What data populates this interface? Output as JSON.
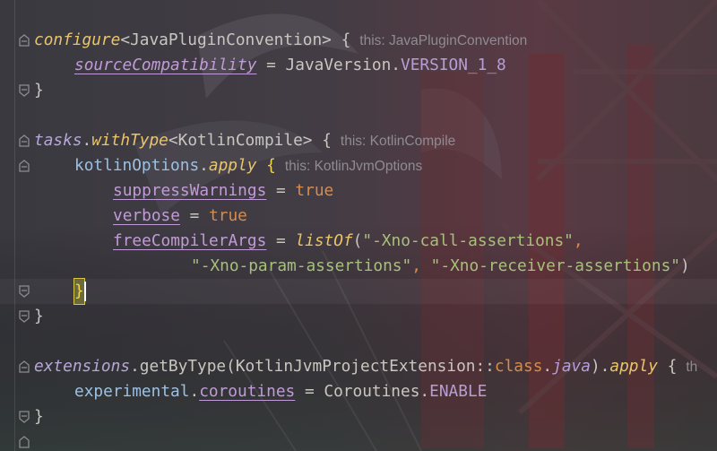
{
  "colors": {
    "background": "#3b3a40",
    "function_italic": "#e8c46a",
    "property": "#c19bd8",
    "keyword": "#d98b4a",
    "string": "#a7c07a",
    "hint": "#8e8c92",
    "brace_highlight": "#f0d34a"
  },
  "editor": {
    "lines": [
      {
        "kind": "l1",
        "fn": "configure",
        "type_arg": "<JavaPluginConvention>",
        "brace": " {",
        "hint": "this: JavaPluginConvention"
      },
      {
        "kind": "l2",
        "prop": "sourceCompatibility",
        "eq": " = ",
        "cls": "JavaVersion.",
        "const": "VERSION_1_8"
      },
      {
        "kind": "close",
        "text": "}"
      },
      {
        "kind": "l4",
        "recv": "tasks",
        "dot": ".",
        "fn": "withType",
        "type_arg": "<KotlinCompile>",
        "brace": " {",
        "hint": "this: KotlinCompile"
      },
      {
        "kind": "l5",
        "recv": "kotlinOptions",
        "dot": ".",
        "fn": "apply",
        "brace": "{",
        "hint": "this: KotlinJvmOptions"
      },
      {
        "kind": "l6",
        "prop": "suppressWarnings",
        "eq": " = ",
        "val": "true"
      },
      {
        "kind": "l7",
        "prop": "verbose",
        "eq": " = ",
        "val": "true"
      },
      {
        "kind": "l8",
        "prop": "freeCompilerArgs",
        "eq": " = ",
        "fn": "listOf",
        "paren": "(",
        "str": "\"-Xno-call-assertions\"",
        "comma": ","
      },
      {
        "kind": "l9",
        "str1": "\"-Xno-param-assertions\"",
        "sep": ", ",
        "str2": "\"-Xno-receiver-assertions\"",
        "paren": ")"
      },
      {
        "kind": "l10",
        "brace": "}"
      },
      {
        "kind": "close",
        "text": "}"
      },
      {
        "kind": "l12",
        "recv": "extensions",
        "dot": ".",
        "fn": "getByType",
        "args": "(KotlinJvmProjectExtension::",
        "kw": "class",
        "dot2": ".",
        "java": "java",
        "close": ").",
        "fn2": "apply",
        "brace": " {",
        "hint": "th"
      },
      {
        "kind": "l13",
        "recv": "experimental",
        "dot": ".",
        "prop": "coroutines",
        "eq": " = ",
        "cls": "Coroutines.",
        "const": "ENABLE"
      },
      {
        "kind": "close",
        "text": "}"
      }
    ]
  }
}
